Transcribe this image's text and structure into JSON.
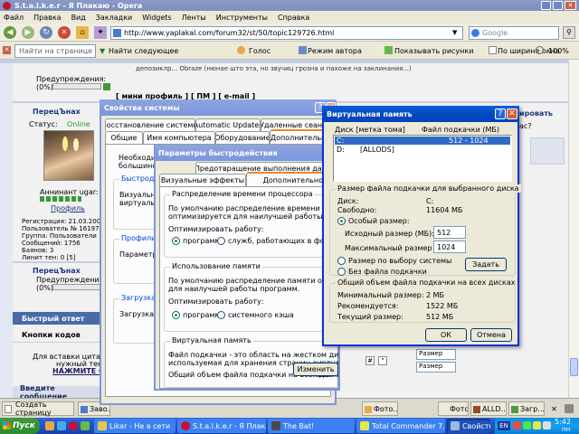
{
  "browser": {
    "title": "S.t.a.l.k.e.r - Я Плакаю - Opera",
    "menu": [
      "Файл",
      "Правка",
      "Вид",
      "Закладки",
      "Widgets",
      "Ленты",
      "Инструменты",
      "Справка"
    ],
    "url": "http://www.yaplakal.com/forum32/st/50/topic129726.html",
    "search_placeholder": "Google",
    "find_placeholder": "Найти на странице",
    "toolbar": {
      "next": "Найти следующее",
      "voice": "Голос",
      "author_mode": "Режим автора",
      "show_images": "Показывать рисунки",
      "fit_width": "По ширине окна",
      "zoom": "100%"
    }
  },
  "forum": {
    "warnings_label": "Предупреждения:",
    "warnings_value": "(0%)",
    "post_snippet": "депозиклр... Obraze (нюнае што эта, но звучиц грозна и пахоже на заклинания...)",
    "profile_links": "[ мини профиль ] [ ПМ ] [ e-mail ]",
    "username": "ПерецЪнах",
    "status_label": "Статус:",
    "status_value": "Online",
    "rank": "Аннинант ugar:",
    "profile_link": "Профиль",
    "stats": [
      "Регистрация: 21.03.200",
      "Пользователь № 16197",
      "Группа: Пользователи",
      "Сообщений: 1756",
      "Баянов: 3",
      "Линит тен: 0 [5]"
    ],
    "username2": "ПерецЪнах",
    "quick_reply": "Быстрый ответ",
    "code_buttons": "Кнопки кодов",
    "quote_help": "Для вставки цитаты нужный текст",
    "press_here": "НАЖМИТЕ СЮ",
    "enter_message": "Введите сообщение",
    "right_link": "ировать",
    "right_text": "ас?",
    "fontsize_label": "Размер",
    "fontsize_value": "Размер"
  },
  "sysprops": {
    "title": "Свойства системы",
    "tabs_row1": [
      "Восстановление системы",
      "Automatic Updates",
      "Удаленные сеансы"
    ],
    "tabs_row2": [
      "Общие",
      "Имя компьютера",
      "Оборудование",
      "Дополнительно"
    ],
    "necessary": "Необходимо",
    "majority": "большинств",
    "group_perf": "Быстродей",
    "visual": "Визуальны",
    "virtual": "виртуальн",
    "group_profiles": "Профили по",
    "params": "Параметры",
    "group_boot": "Загрузка и в",
    "boot": "Загрузка и в"
  },
  "perf": {
    "title": "Параметры быстродействия",
    "tabs": [
      "Предотвращение выполнения данных",
      "Визуальные эффекты",
      "Дополнительно"
    ],
    "sched_group": "Распределение времени процессора",
    "sched_text": [
      "По умолчанию распределение времени процессора",
      "оптимизируется для наилучшей работы программ."
    ],
    "optimize_label": "Оптимизировать работу:",
    "opt_programs": "программ",
    "opt_services": "служб, работающих в фоновом ре",
    "mem_group": "Использование памяти",
    "mem_text": [
      "По умолчанию распределение памяти оптимизируется",
      "для наилучшей работы программ."
    ],
    "mem_optimize_label": "Оптимизировать работу:",
    "mem_programs": "программ",
    "mem_cache": "системного кэша",
    "vm_group": "Виртуальная память",
    "vm_text": [
      "Файл подкачки - это область на жестком диске,",
      "используемая для хранения страниц виртуальной памяти."
    ],
    "vm_total_label": "Общий объем файла подкачки на всех дисках:",
    "vm_total_value": "512 МБ",
    "change_button": "Изменить"
  },
  "vm": {
    "title": "Виртуальная память",
    "col_drive": "Диск [метка тома]",
    "col_pagefile": "Файл подкачки (МБ)",
    "drives": [
      {
        "drive": "C:",
        "label": "",
        "size": "512 - 1024"
      },
      {
        "drive": "D:",
        "label": "[ALLODS]",
        "size": ""
      }
    ],
    "selected_group": "Размер файла подкачки для выбранного диска",
    "disk_label": "Диск:",
    "disk_value": "C:",
    "free_label": "Свободно:",
    "free_value": "11604 МБ",
    "custom_size": "Особый размер:",
    "initial_label": "Исходный размер (МБ):",
    "initial_value": "512",
    "max_label": "Максимальный размер (МБ):",
    "max_value": "1024",
    "system_size": "Размер по выбору системы",
    "no_pagefile": "Без файла подкачки",
    "set_button": "Задать",
    "total_group": "Общий объем файла подкачки на всех дисках",
    "min_label": "Минимальный размер:",
    "min_value": "2 МБ",
    "rec_label": "Рекомендуется:",
    "rec_value": "1522 МБ",
    "cur_label": "Текущий размер:",
    "cur_value": "512 МБ",
    "ok": "ОК",
    "cancel": "Отмена"
  },
  "opera_tabs": [
    "Создать страницу",
    "Заво...",
    "Фото...",
    "ALLD...",
    "Загр..."
  ],
  "taskbar": {
    "start": "Пуск",
    "tasks": [
      "Likar - Не в сети",
      "S.t.a.l.k.e.r - Я Плака...",
      "The Bat!",
      "Total Commander 7.0 p...",
      "Свойства системы"
    ],
    "lang": "EN",
    "time": "5:42",
    "day": "пн"
  }
}
